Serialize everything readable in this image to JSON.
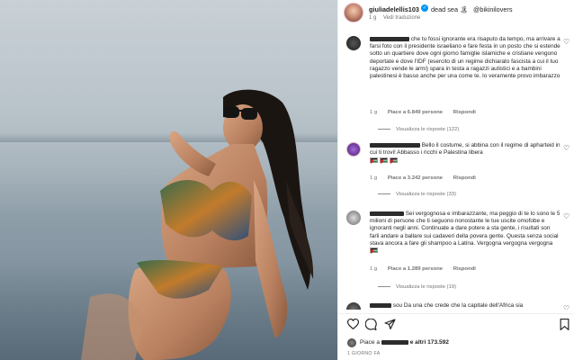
{
  "post": {
    "username": "giuliadelellis103",
    "verified_icon": "verified-badge-icon",
    "location": "dead sea 🏝",
    "tagged": "@bikinilovers",
    "time": "1 g",
    "translate": "Vedi traduzione"
  },
  "comments": [
    {
      "username": "",
      "text": "che tu fossi ignorante era risaputo da tempo, ma arrivare a farsi foto con il presidente israeliano e fare festa in un posto che si estende sotto un quartiere dove ogni giorno famiglie islamiche e cristiane vengono deportate e dove l'IDF (esercito di un regime dichiarato fascista a cui il tuo ragazzo vende le armi) spara in testa a ragazzi autistici e a bambini palestinesi è basso anche per una come te. Io veramente provo imbarazzo",
      "time": "1 g",
      "likes": "Piace a 6.849 persone",
      "reply": "Rispondi",
      "replies": "Visualizza le risposte (122)"
    },
    {
      "username": "",
      "text": "Bello il costume, si abbina con il regime di apharteid in cui ti trovi! Abbasso i ricchi e Palestina libera",
      "flags": "🇵🇸🇵🇸🇵🇸",
      "time": "1 g",
      "likes": "Piace a 3.242 persone",
      "reply": "Rispondi",
      "replies": "Visualizza le risposte (33)"
    },
    {
      "username": "",
      "text": "Sei vergognosa e imbarazzante, ma peggio di te lo sono le 5 milioni di persone che ti seguono nonostante le tue uscite omofobe e ignoranti negli anni. Continuate a dare potere a sta gente, i risultati son farli andare a ballare sui cadaveri della povera gente. Questa senza social stava ancora a fare gli shampoo a Latina. Vergogna vergogna vergogna",
      "time": "1 g",
      "likes": "Piace a 1.289 persone",
      "reply": "Rispondi",
      "replies": "Visualizza le risposte (19)"
    },
    {
      "username": "",
      "text": "sou Da una che crede che la capitale dell'Africa sia"
    }
  ],
  "actions": {
    "like_icon": "heart-outline-icon",
    "comment_icon": "comment-bubble-icon",
    "share_icon": "paper-plane-icon",
    "save_icon": "bookmark-icon"
  },
  "likes_summary": {
    "prefix": "Piace a",
    "suffix": "e altri 173.592",
    "date": "1 GIORNO FA"
  }
}
